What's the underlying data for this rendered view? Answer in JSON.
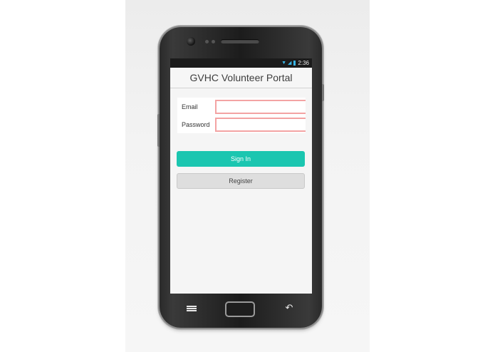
{
  "status_bar": {
    "time": "2:36",
    "icons": [
      "wifi-icon",
      "signal-icon",
      "battery-icon"
    ]
  },
  "app": {
    "title": "GVHC Volunteer Portal"
  },
  "form": {
    "email_label": "Email",
    "email_value": "",
    "password_label": "Password",
    "password_value": ""
  },
  "buttons": {
    "sign_in": "Sign In",
    "register": "Register"
  },
  "colors": {
    "accent": "#1bc6b0",
    "input_error_border": "#f3a3a3"
  }
}
